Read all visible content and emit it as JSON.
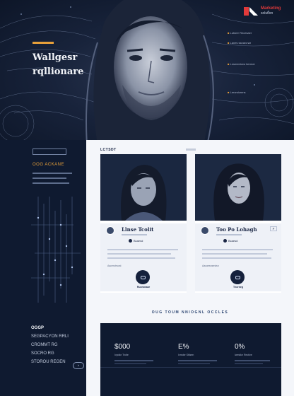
{
  "brand": {
    "name": "Marketing",
    "tagline": "solution",
    "accent_color": "#e23a3a"
  },
  "hero": {
    "title_line1": "Wallgesr",
    "title_line2": "rqllionare",
    "accent_color": "#e7a03a",
    "notes": [
      "Lutsrre Recesaer",
      "Lanes ssnarcnar",
      "Lnsmeeiorw bermer",
      "Lerorsicrens"
    ]
  },
  "sidebar": {
    "button_label": "",
    "heading": "OOG ACKANE",
    "footer": {
      "title": "OGGP",
      "lines": [
        "SEGPACYON RRLI",
        "CROMMT RG",
        "SOCRO RG",
        "STOROU REGEN"
      ]
    }
  },
  "main": {
    "section_label": "LCTSDT",
    "cards": [
      {
        "name": "Llnse Tcolit",
        "role": "Tecaer",
        "chip": "Bcaesd",
        "tag": "",
        "mini": "Aacerotrscst",
        "footer": "Ruoronaae"
      },
      {
        "name": "Too Po Lohagh",
        "role": "Tescesoro",
        "chip": "Bcaesd",
        "tag": "P",
        "mini": "Aacaesnsestsn",
        "footer": "Tnorneg"
      }
    ],
    "services_title": "OUG TOUM NNIOGNL OCCLES",
    "stats": [
      {
        "top": "",
        "value": "$000",
        "sub": "Ivpdicr Trctie"
      },
      {
        "top": "",
        "value": "E%",
        "sub": "Ivmdnr Stltzen"
      },
      {
        "top": "",
        "value": "0%",
        "sub": "Iwmdicr Rective"
      }
    ],
    "pager": "≥"
  }
}
